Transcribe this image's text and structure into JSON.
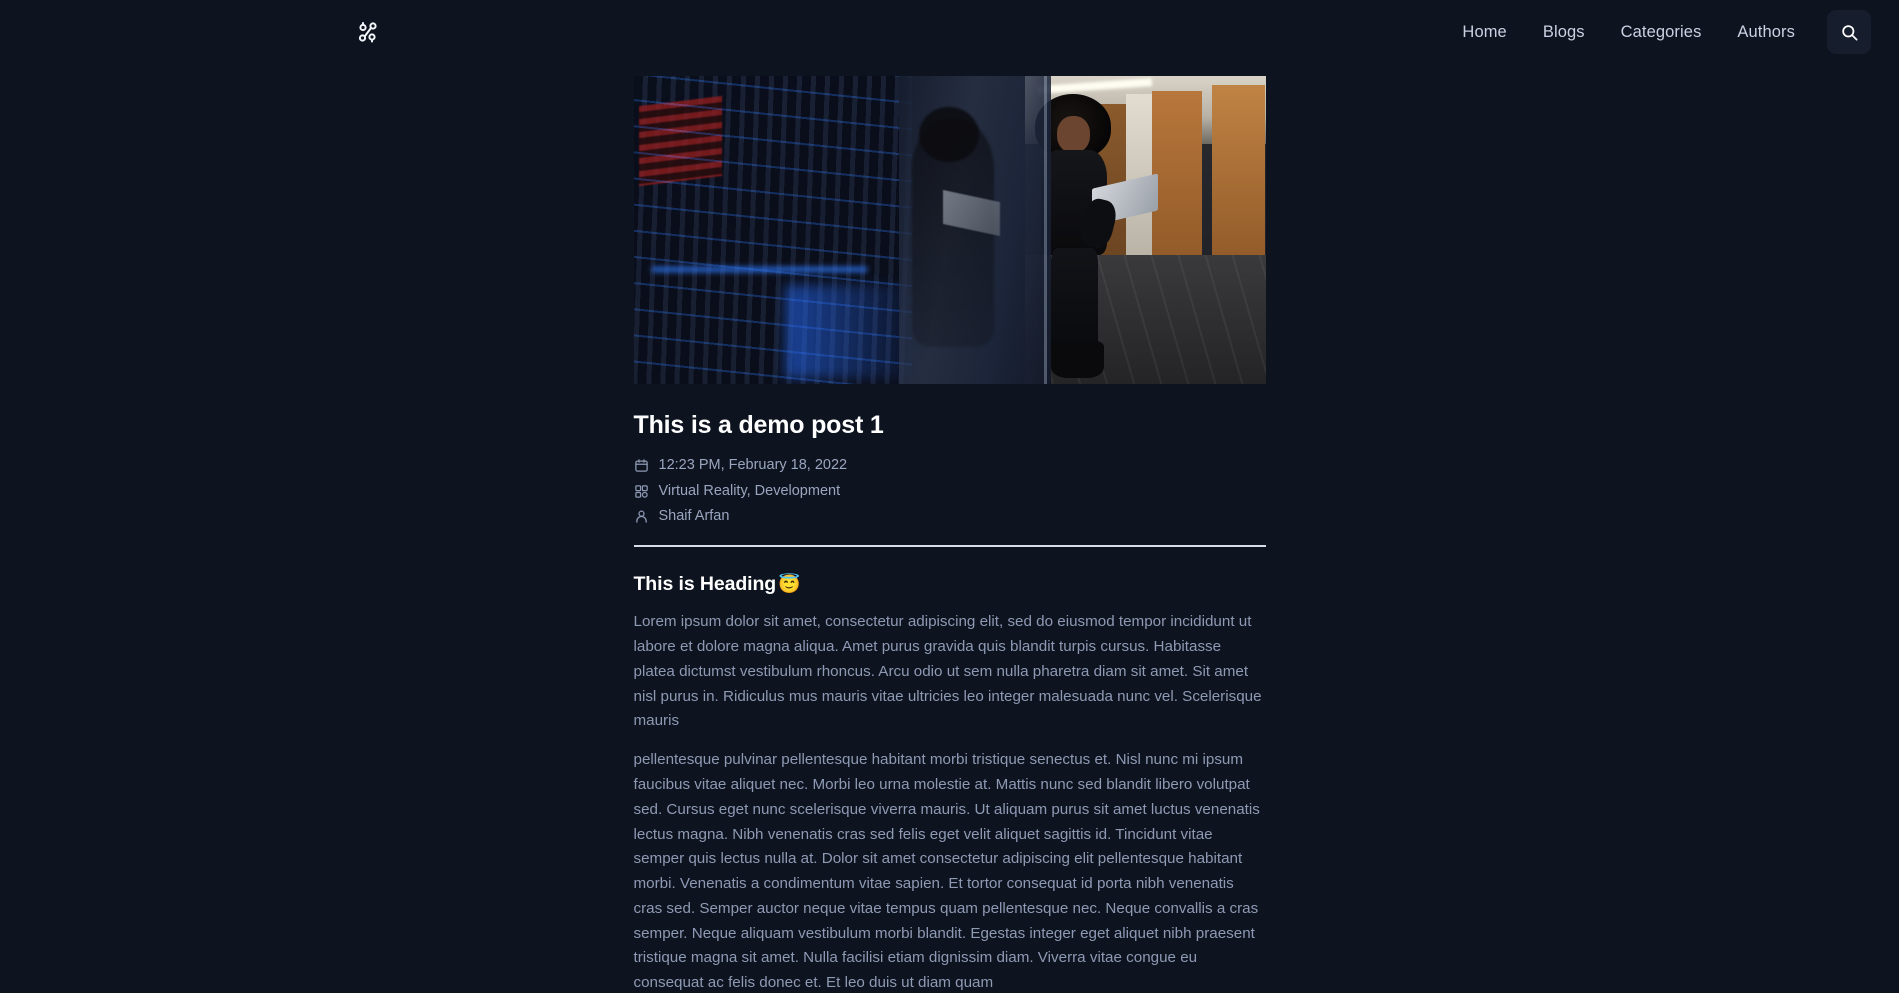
{
  "theme": {
    "background": "#0d131f",
    "nav_text": "#c9d1e3",
    "title_text": "#ffffff",
    "body_text": "#8e9ab4",
    "meta_text": "#9aa6bf",
    "divider": "#d8dde8",
    "search_button_bg": "#161d2c"
  },
  "header": {
    "logo_name": "share-network-logo",
    "nav_links": [
      {
        "label": "Home"
      },
      {
        "label": "Blogs"
      },
      {
        "label": "Categories"
      },
      {
        "label": "Authors"
      }
    ],
    "search_icon": "search-icon"
  },
  "post": {
    "hero_image_alt": "Woman holding a laptop walking past a glass wall beside server racks in a data center corridor",
    "title": "This is a demo post 1",
    "meta": {
      "date_icon": "calendar-icon",
      "date": "12:23 PM, February 18, 2022",
      "categories_icon": "grid-icon",
      "categories": "Virtual Reality, Development",
      "author_icon": "user-icon",
      "author": "Shaif Arfan"
    },
    "heading": "This is Heading",
    "heading_emoji": "😇",
    "paragraphs": [
      "Lorem ipsum dolor sit amet, consectetur adipiscing elit, sed do eiusmod tempor incididunt ut labore et dolore magna aliqua. Amet purus gravida quis blandit turpis cursus. Habitasse platea dictumst vestibulum rhoncus. Arcu odio ut sem nulla pharetra diam sit amet. Sit amet nisl purus in. Ridiculus mus mauris vitae ultricies leo integer malesuada nunc vel. Scelerisque mauris",
      "pellentesque pulvinar pellentesque habitant morbi tristique senectus et. Nisl nunc mi ipsum faucibus vitae aliquet nec. Morbi leo urna molestie at. Mattis nunc sed blandit libero volutpat sed. Cursus eget nunc scelerisque viverra mauris. Ut aliquam purus sit amet luctus venenatis lectus magna. Nibh venenatis cras sed felis eget velit aliquet sagittis id. Tincidunt vitae semper quis lectus nulla at. Dolor sit amet consectetur adipiscing elit pellentesque habitant morbi. Venenatis a condimentum vitae sapien. Et tortor consequat id porta nibh venenatis cras sed. Semper auctor neque vitae tempus quam pellentesque nec. Neque convallis a cras semper. Neque aliquam vestibulum morbi blandit. Egestas integer eget aliquet nibh praesent tristique magna sit amet. Nulla facilisi etiam dignissim diam. Viverra vitae congue eu consequat ac felis donec et. Et leo duis ut diam quam"
    ]
  }
}
